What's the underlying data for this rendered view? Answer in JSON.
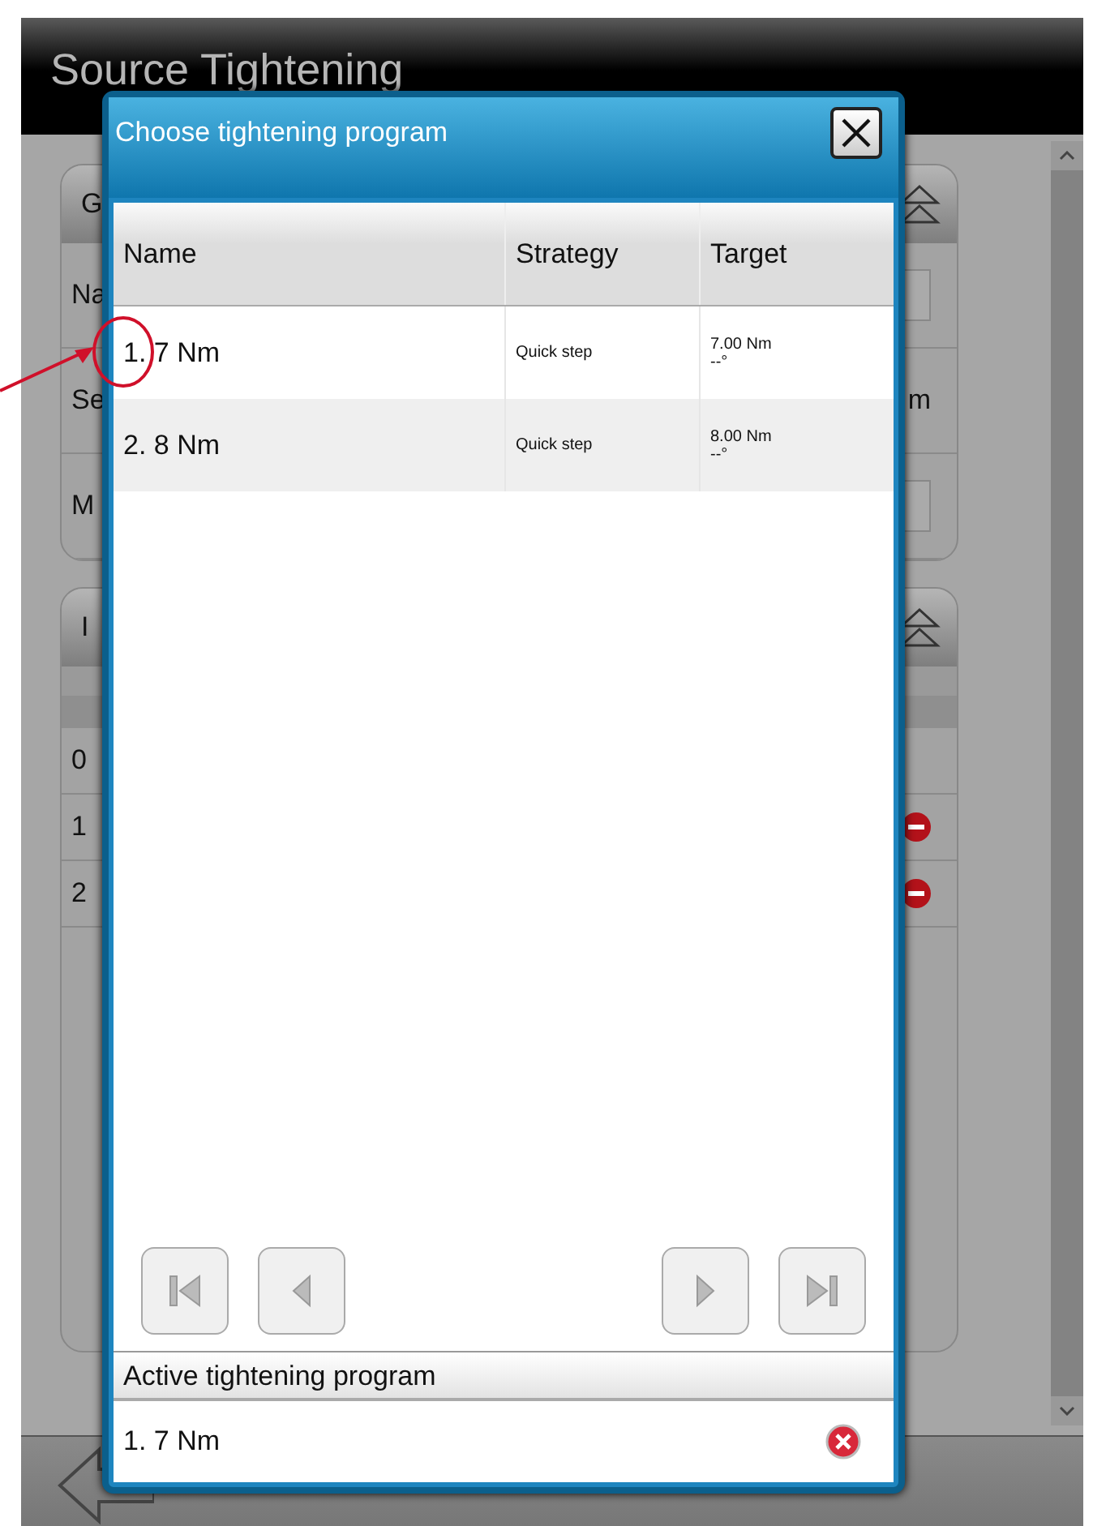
{
  "app": {
    "title": "Source Tightening"
  },
  "panels": [
    {
      "heading": "G",
      "rows": [
        {
          "label": "Na",
          "kind": "field"
        },
        {
          "label": "Se",
          "kind": "text",
          "value": "m"
        },
        {
          "label": "M",
          "kind": "field"
        }
      ]
    },
    {
      "heading": "I",
      "rows": [
        {
          "label": "0",
          "kind": "plain"
        },
        {
          "label": "1",
          "kind": "remove"
        },
        {
          "label": "2",
          "kind": "remove"
        }
      ]
    }
  ],
  "dialog": {
    "title": "Choose tightening program",
    "columns": [
      "Name",
      "Strategy",
      "Target"
    ],
    "rows": [
      {
        "name": "1. 7 Nm",
        "strategy": "Quick step",
        "torque": "7.00 Nm",
        "angle": "--°"
      },
      {
        "name": "2. 8 Nm",
        "strategy": "Quick step",
        "torque": "8.00 Nm",
        "angle": "--°"
      }
    ],
    "pager": [
      {
        "kind": "first",
        "disabled": true
      },
      {
        "kind": "previous",
        "disabled": true
      },
      {
        "kind": "next",
        "disabled": true
      },
      {
        "kind": "last",
        "disabled": true
      }
    ],
    "active": {
      "heading": "Active tightening program",
      "value": "1. 7 Nm"
    }
  }
}
